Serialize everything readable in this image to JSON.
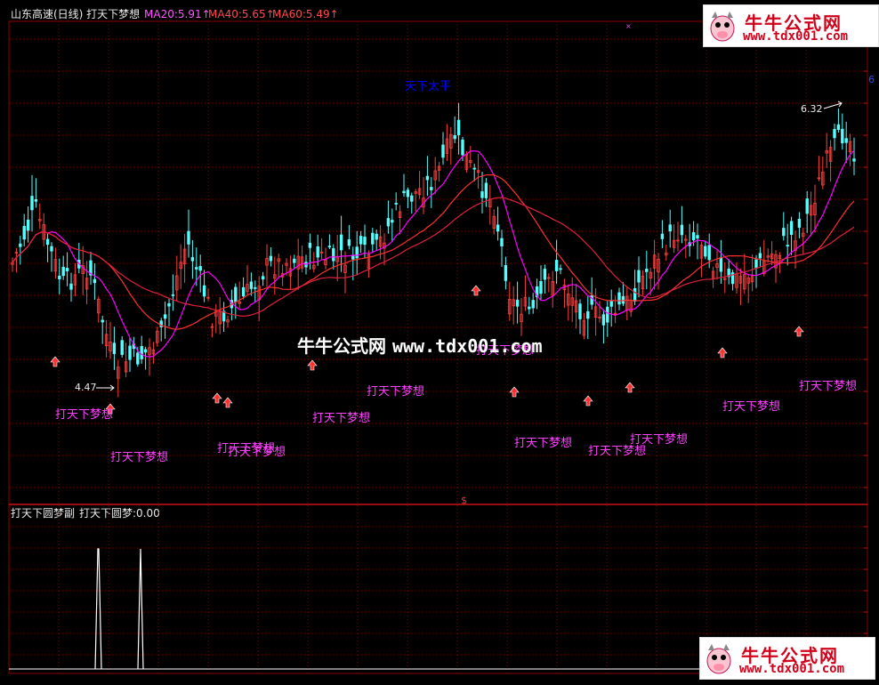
{
  "header": {
    "stock_title": "山东高速(日线) 打天下梦想",
    "ma20": "MA20:5.91",
    "ma40": "MA40:5.65",
    "ma60": "MA60:5.49",
    "arrow": "↑"
  },
  "sub_header": {
    "title": "打天下圆梦副",
    "value": "打天下圆梦:0.00"
  },
  "watermark": {
    "brand": "牛牛公式网",
    "url": "www.tdx001.com",
    "center_brand": "牛牛公式网",
    "center_url": "www.tdx001.com"
  },
  "colors": {
    "background": "#000000",
    "grid": "#8b0000",
    "up_candle": "#ff4040",
    "down_candle": "#54ffff",
    "ma20": "#ff00ff",
    "ma40": "#ff3030",
    "ma60": "#e0203c",
    "signal_text": "#ff40ff",
    "top_signal_text": "#0000ff"
  },
  "chart_data": {
    "type": "candlestick",
    "low_marker": "4.47",
    "high_marker": "6.32",
    "top_signal": "天下太平",
    "signal_label": "打天下梦想",
    "right_edge_label": "6",
    "cursor_label": "$",
    "ma20": "5.91",
    "ma40": "5.65",
    "ma60": "5.49",
    "sub_indicator": {
      "name": "打天下圆梦",
      "value": "0.00",
      "spikes": 2
    }
  }
}
